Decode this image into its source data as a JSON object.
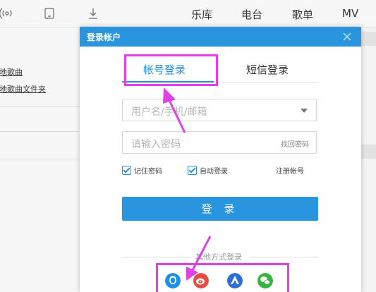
{
  "topbar": {
    "icons": [
      "broadcast-icon",
      "device-icon",
      "download-icon"
    ],
    "tabs": [
      "乐库",
      "电台",
      "歌单",
      "MV"
    ]
  },
  "left_pane": {
    "links": [
      "本地歌曲",
      "本地歌曲文件夹"
    ]
  },
  "dialog": {
    "title": "登录帐户",
    "tabs": {
      "account": "帐号登录",
      "sms": "短信登录"
    },
    "username_placeholder": "用户名/手机/邮箱",
    "password_placeholder": "请输入密码",
    "find_password": "找回密码",
    "remember_password": "记住密码",
    "auto_login": "自动登录",
    "register": "注册帐号",
    "login_button": "登 录",
    "other_methods": "其他方式登录",
    "social_icons": [
      "qq-icon",
      "weibo-icon",
      "baidu-icon",
      "wechat-icon"
    ]
  },
  "colors": {
    "accent": "#2a95df",
    "highlight": "#e040e8"
  }
}
